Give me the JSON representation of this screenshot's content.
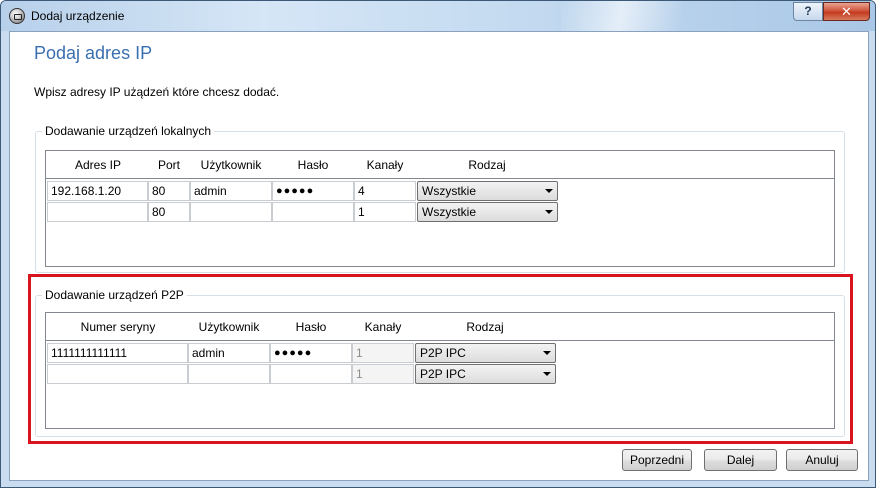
{
  "window": {
    "title": "Dodaj urządzenie",
    "help_label": "?",
    "close_label": "✕"
  },
  "page": {
    "title": "Podaj adres IP",
    "intro": "Wpisz adresy IP użądzeń które chcesz dodać."
  },
  "local_group": {
    "legend": "Dodawanie urządzeń lokalnych",
    "columns": [
      "Adres IP",
      "Port",
      "Użytkownik",
      "Hasło",
      "Kanały",
      "Rodzaj"
    ],
    "rows": [
      {
        "ip": "192.168.1.20",
        "port": "80",
        "user": "admin",
        "password": "●●●●●",
        "channels": "4",
        "type": "Wszystkie"
      },
      {
        "ip": "",
        "port": "80",
        "user": "",
        "password": "",
        "channels": "1",
        "type": "Wszystkie"
      }
    ]
  },
  "p2p_group": {
    "legend": "Dodawanie urządzeń P2P",
    "columns": [
      "Numer seryny",
      "Użytkownik",
      "Hasło",
      "Kanały",
      "Rodzaj"
    ],
    "rows": [
      {
        "serial": "1111111111111",
        "user": "admin",
        "password": "●●●●●",
        "channels": "1",
        "type": "P2P IPC"
      },
      {
        "serial": "",
        "user": "",
        "password": "",
        "channels": "1",
        "type": "P2P IPC"
      }
    ]
  },
  "buttons": {
    "back": "Poprzedni",
    "next": "Dalej",
    "cancel": "Anuluj"
  },
  "colors": {
    "highlight": "#d8141e",
    "title": "#3a6fb0"
  }
}
